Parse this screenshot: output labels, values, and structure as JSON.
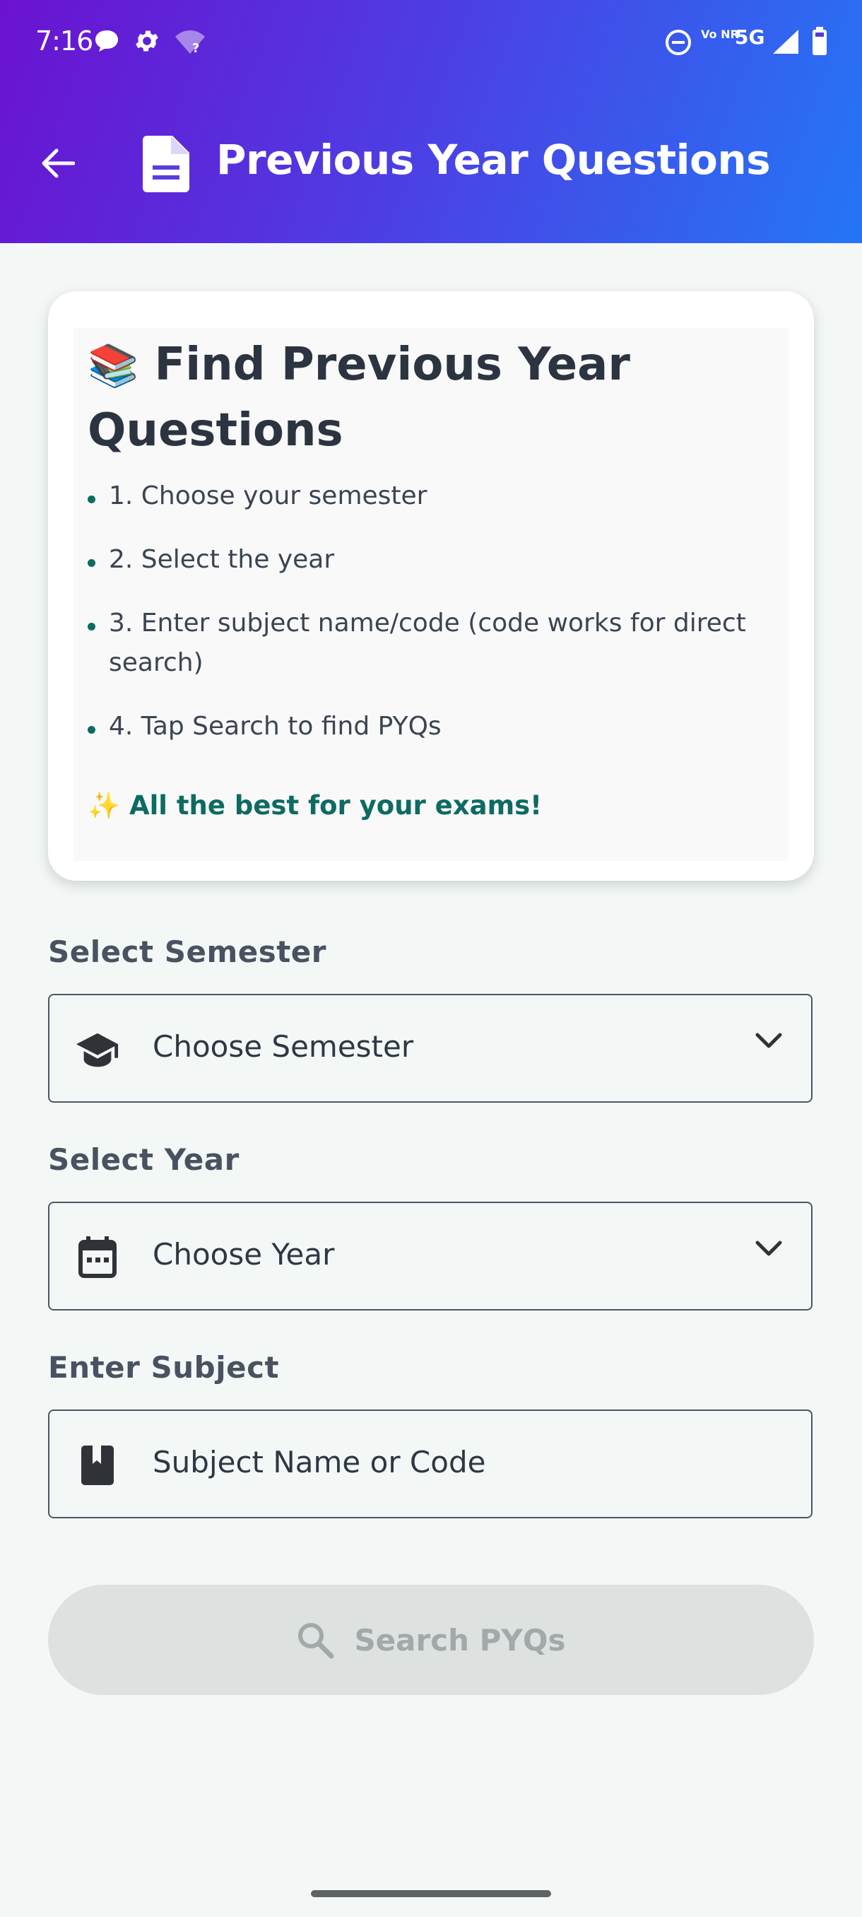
{
  "status_bar": {
    "time": "7:16",
    "network_label": "5G",
    "volte_label": "Vo NR"
  },
  "appbar": {
    "title": "Previous Year Questions",
    "back_icon": "arrow-left-icon",
    "title_icon": "document-icon"
  },
  "info_card": {
    "title_emoji": "📚",
    "title": "Find Previous Year Questions",
    "steps": [
      "1. Choose your semester",
      "2. Select the year",
      "3. Enter subject name/code (code works for direct search)",
      "4. Tap Search to find PYQs"
    ],
    "footer_emoji": "✨",
    "footer": "All the best for your exams!"
  },
  "form": {
    "semester": {
      "label": "Select Semester",
      "placeholder": "Choose Semester",
      "icon": "graduation-cap-icon"
    },
    "year": {
      "label": "Select Year",
      "placeholder": "Choose Year",
      "icon": "calendar-icon"
    },
    "subject": {
      "label": "Enter Subject",
      "placeholder": "Subject Name or Code",
      "icon": "book-icon"
    }
  },
  "search_button": {
    "label": "Search PYQs",
    "icon": "search-icon"
  },
  "colors": {
    "header_gradient_start": "#6b12cf",
    "header_gradient_end": "#2476f6",
    "accent_teal": "#0d6b62",
    "background": "#f3f8f7",
    "button_disabled": "#dde1e0"
  }
}
